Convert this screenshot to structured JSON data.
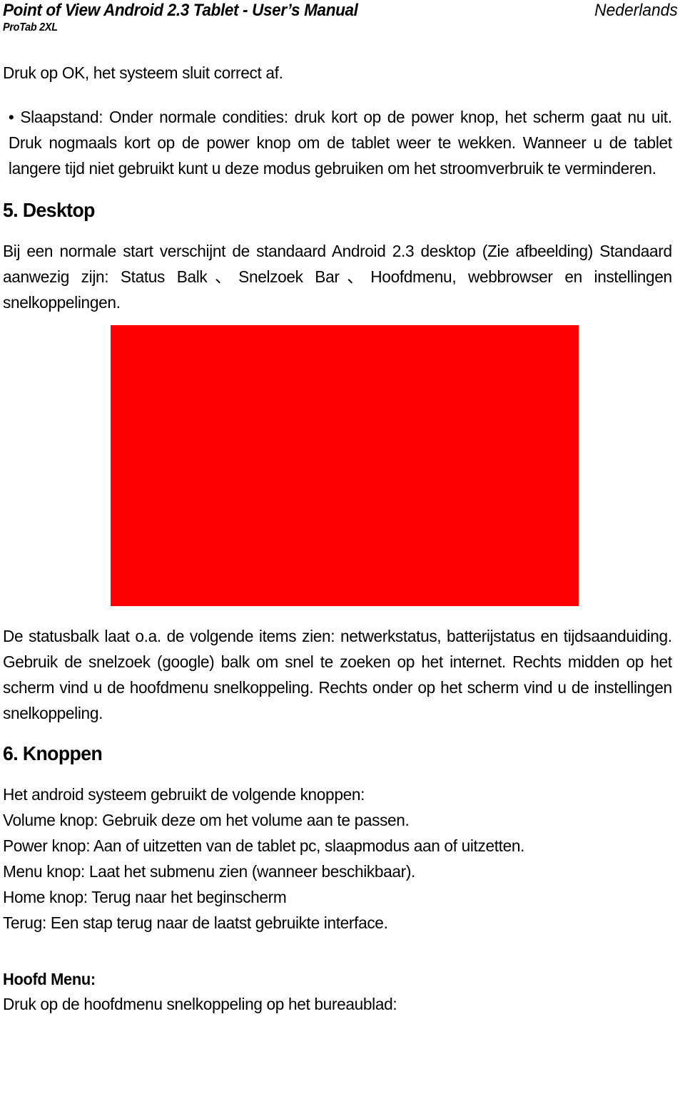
{
  "header": {
    "title": "Point of View Android 2.3 Tablet - User’s Manual",
    "model": "ProTab 2XL",
    "language": "Nederlands"
  },
  "body": {
    "intro_line": "Druk op OK, het systeem sluit correct af.",
    "sleep_bullet": "• Slaapstand: Onder normale condities: druk kort op de power knop, het scherm gaat nu uit. Druk nogmaals kort op de power knop om de tablet weer te wekken. Wanneer u de tablet langere tijd niet gebruikt kunt u deze modus gebruiken om het stroomverbruik te verminderen.",
    "section_desktop": {
      "heading": "5. Desktop",
      "paragraph": "Bij een normale start verschijnt de standaard Android 2.3 desktop (Zie afbeelding) Standaard aanwezig zijn: Status Balk、Snelzoek Bar、Hoofdmenu, webbrowser en instellingen snelkoppelingen.",
      "figure": {
        "alt": "Android 2.3 desktop screenshot",
        "fill_color": "#ff0000"
      },
      "after_figure": "De statusbalk laat o.a. de volgende items zien: netwerkstatus, batterijstatus en tijdsaanduiding. Gebruik de snelzoek (google) balk om snel te zoeken op het internet. Rechts midden op het scherm vind u de hoofdmenu snelkoppeling. Rechts onder op het scherm vind u de instellingen snelkoppeling."
    },
    "section_buttons": {
      "heading": "6. Knoppen",
      "lead": "Het android systeem gebruikt de volgende knoppen:",
      "lines": [
        "Volume knop: Gebruik deze om het volume aan te passen.",
        "Power knop: Aan of uitzetten van de tablet pc, slaapmodus aan of uitzetten.",
        "Menu knop: Laat het submenu zien (wanneer beschikbaar).",
        "Home knop: Terug naar het beginscherm",
        "Terug: Een stap terug naar de laatst gebruikte interface."
      ]
    },
    "main_menu": {
      "heading": "Hoofd Menu:",
      "line": "Druk op de hoofdmenu snelkoppeling op het bureaublad:"
    }
  }
}
